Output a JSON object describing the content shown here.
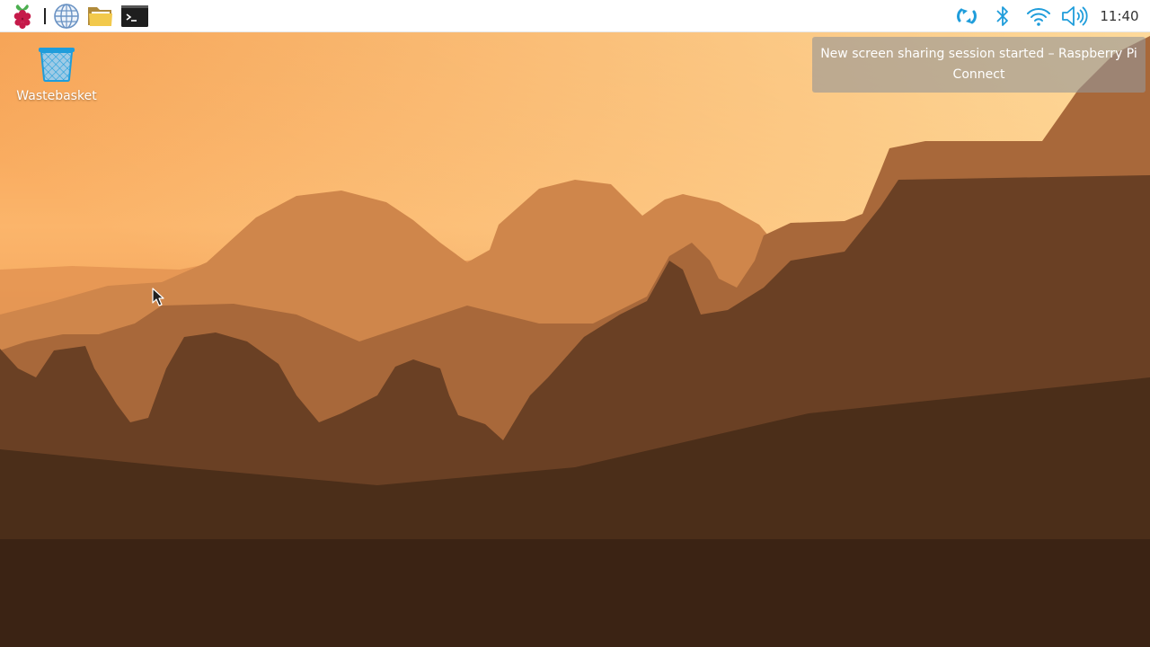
{
  "taskbar": {
    "launchers": [
      {
        "name": "raspberry-menu",
        "icon": "raspberry-icon"
      },
      {
        "name": "web-browser",
        "icon": "globe-icon"
      },
      {
        "name": "file-manager",
        "icon": "folder-icon"
      },
      {
        "name": "terminal",
        "icon": "terminal-icon"
      }
    ],
    "tray": {
      "icons": [
        "connect-icon",
        "bluetooth-icon",
        "wifi-icon",
        "volume-icon"
      ],
      "accent_color": "#1f9ddb"
    },
    "clock": "11:40"
  },
  "desktop": {
    "icons": [
      {
        "label": "Wastebasket",
        "icon": "trash-icon"
      }
    ]
  },
  "notification": {
    "text": "New screen sharing session started – Raspberry Pi Connect"
  }
}
